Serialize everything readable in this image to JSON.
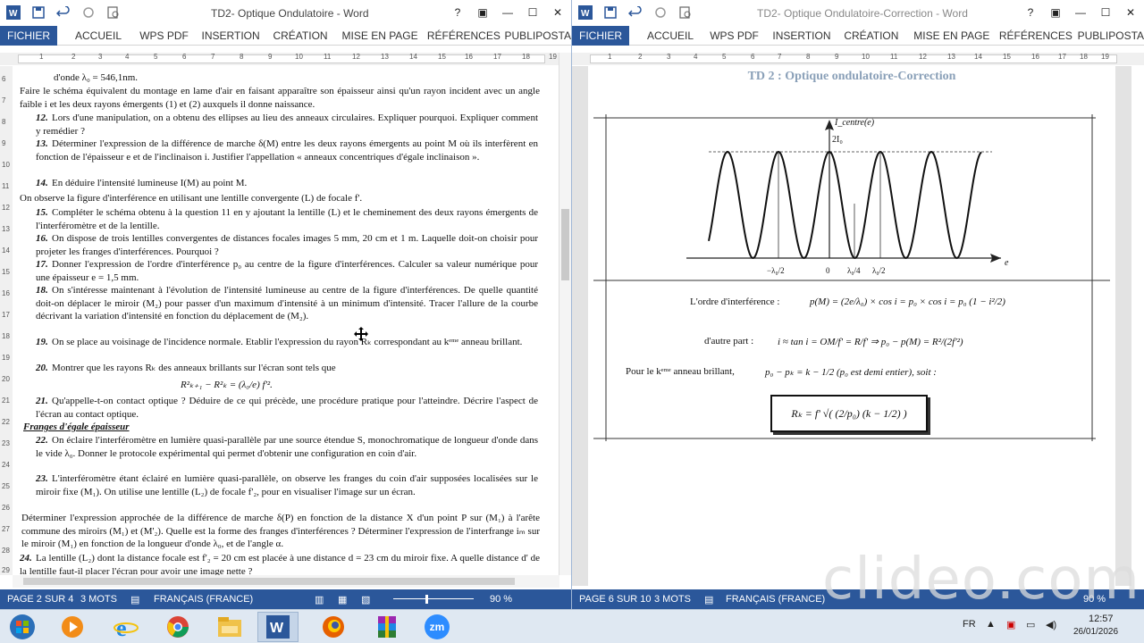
{
  "left_window": {
    "title": "TD2- Optique Ondulatoire - Word",
    "tabs": [
      "FICHIER",
      "ACCUEIL",
      "WPS PDF",
      "INSERTION",
      "CRÉATION",
      "MISE EN PAGE",
      "RÉFÉRENCES",
      "PUBLIPOSTA"
    ],
    "ruler_numbers": [
      "1",
      "2",
      "3",
      "4",
      "5",
      "6",
      "7",
      "8",
      "9",
      "10",
      "11",
      "12",
      "13",
      "14",
      "15",
      "16",
      "17",
      "18",
      "19"
    ],
    "vruler_numbers": [
      "6",
      "7",
      "8",
      "9",
      "10",
      "11",
      "12",
      "13",
      "14",
      "15",
      "16",
      "17",
      "18",
      "19",
      "20",
      "21",
      "22",
      "23",
      "24",
      "25",
      "26",
      "27",
      "28",
      "29"
    ],
    "paragraphs": [
      {
        "num": "",
        "text": "d'onde λ₀ = 546,1nm."
      },
      {
        "num": "",
        "text": "Faire le schéma équivalent du montage en lame d'air en faisant apparaître son épaisseur ainsi qu'un rayon incident avec un angle faible i et les deux rayons émergents (1) et (2) auxquels il donne naissance."
      },
      {
        "num": "12.",
        "text": "Lors d'une manipulation, on a obtenu des ellipses au lieu des anneaux circulaires. Expliquer pourquoi. Expliquer comment y remédier ?"
      },
      {
        "num": "13.",
        "text": "Déterminer l'expression de la différence de marche δ(M) entre les deux rayons émergents au point M où ils interfèrent en fonction de l'épaisseur e et de l'inclinaison i. Justifier l'appellation « anneaux concentriques d'égale inclinaison »."
      },
      {
        "num": "14.",
        "text": "En déduire l'intensité lumineuse I(M) au point M."
      },
      {
        "num": "",
        "text": "On observe la figure d'interférence en utilisant une lentille convergente (L) de focale f'."
      },
      {
        "num": "15.",
        "text": "Compléter le schéma obtenu à la question 11 en y ajoutant la lentille (L) et le cheminement des deux rayons émergents de l'interféromètre et de la lentille."
      },
      {
        "num": "16.",
        "text": "On dispose de trois lentilles convergentes de distances focales images 5 mm, 20 cm et 1 m. Laquelle doit-on choisir pour projeter les franges d'interférences. Pourquoi ?"
      },
      {
        "num": "17.",
        "text": "Donner l'expression de l'ordre d'interférence p₀ au centre de la figure d'interférences. Calculer sa valeur numérique pour une épaisseur e = 1,5 mm."
      },
      {
        "num": "18.",
        "text": "On s'intéresse maintenant à l'évolution de l'intensité lumineuse au centre de la figure d'interférences. De quelle quantité doit-on déplacer le miroir (M₂) pour passer d'un maximum d'intensité à un minimum d'intensité. Tracer l'allure de la courbe décrivant la variation d'intensité en fonction du déplacement de (M₂)."
      },
      {
        "num": "19.",
        "text": "On se place au voisinage de l'incidence normale. Etablir l'expression du rayon Rₖ correspondant au kᵉᵐᵉ anneau brillant."
      },
      {
        "num": "20.",
        "text": "Montrer que les rayons Rₖ des anneaux brillants sur l'écran sont tels que"
      },
      {
        "num": "",
        "text": "R²ₖ₊₁ − R²ₖ = (λ₀/e) f'²."
      },
      {
        "num": "21.",
        "text": "Qu'appelle-t-on contact optique ? Déduire de ce qui précède, une procédure pratique pour l'atteindre. Décrire l'aspect de l'écran au contact optique."
      },
      {
        "num": "",
        "text": "Franges d'égale épaisseur"
      },
      {
        "num": "22.",
        "text": "On éclaire l'interféromètre en lumière quasi-parallèle par une source étendue S, monochromatique de longueur d'onde dans le vide λ₀. Donner le protocole expérimental qui permet d'obtenir une configuration en coin d'air."
      },
      {
        "num": "23.",
        "text": "L'interféromètre étant éclairé en lumière quasi-parallèle, on observe les franges du coin d'air supposées localisées sur le miroir fixe (M₁). On utilise une lentille (L₂) de focale f'₂, pour en visualiser l'image sur un écran."
      },
      {
        "num": "",
        "text": "Déterminer l'expression approchée de la différence de marche δ(P) en fonction de la distance X d'un point P sur (M₁) à l'arête commune des miroirs (M₁) et (M'₂). Quelle est la forme des franges d'interférences ? Déterminer l'expression de l'interfrange iₘ sur le miroir (M₁) en fonction de la longueur d'onde λ₀, et de l'angle α."
      },
      {
        "num": "24.",
        "text": "La lentille (L₂) dont la distance focale est f'₂ = 20 cm est placée à une distance d = 23 cm du miroir fixe. A quelle distance d' de la lentille faut-il placer l'écran pour avoir une image nette ?"
      }
    ],
    "status": {
      "page": "PAGE 2 SUR 4",
      "words": "3 MOTS",
      "lang": "FRANÇAIS (FRANCE)",
      "zoom": "90 %"
    }
  },
  "right_window": {
    "title": "TD2- Optique Ondulatoire-Correction - Word",
    "tabs": [
      "FICHIER",
      "ACCUEIL",
      "WPS PDF",
      "INSERTION",
      "CRÉATION",
      "MISE EN PAGE",
      "RÉFÉRENCES",
      "PUBLIPOSTA"
    ],
    "ruler_numbers": [
      "1",
      "2",
      "3",
      "4",
      "5",
      "6",
      "7",
      "8",
      "9",
      "10",
      "11",
      "12",
      "13",
      "14",
      "15",
      "16",
      "17",
      "18",
      "19"
    ],
    "doc_title": "TD 2 : Optique ondulatoire-Correction",
    "graph": {
      "ylabel": "I_centre(e)",
      "ymax_label": "2I₀",
      "xlabel": "e",
      "tick_labels": [
        "−λ₀/2",
        "0",
        "λ₀/4",
        "λ₀/2"
      ]
    },
    "equations": {
      "order_label": "L'ordre d'interférence :",
      "order_eq": "p(M) = (2e/λ₀) × cos i = p₀ × cos i = p₀ (1 − i²/2)",
      "approx_label": "d'autre part :",
      "approx_eq": "i ≈ tan i = OM/f' = R/f'   ⇒   p₀ − p(M) = R²/(2f'²)",
      "ring_label": "Pour le kᵉᵐᵉ anneau brillant,",
      "ring_eq": "p₀ − pₖ = k − 1/2   (p₀ est demi entier), soit :",
      "boxed": "Rₖ = f' √( (2/p₀) (k − 1/2) )"
    },
    "status": {
      "page": "PAGE 6 SUR 10",
      "words": "3 MOTS",
      "lang": "FRANÇAIS (FRANCE)",
      "zoom": "90 %"
    }
  },
  "taskbar": {
    "apps": [
      "start",
      "media-player",
      "internet-explorer",
      "chrome",
      "file-explorer",
      "word",
      "firefox",
      "winrar",
      "zoom"
    ],
    "zoom_label": "zm",
    "lang": "FR",
    "time": "12:57",
    "date": "26/01/2026"
  },
  "watermark": "clideo.com",
  "colors": {
    "word_blue": "#2b579a",
    "taskbar": "#dfe8f2"
  }
}
